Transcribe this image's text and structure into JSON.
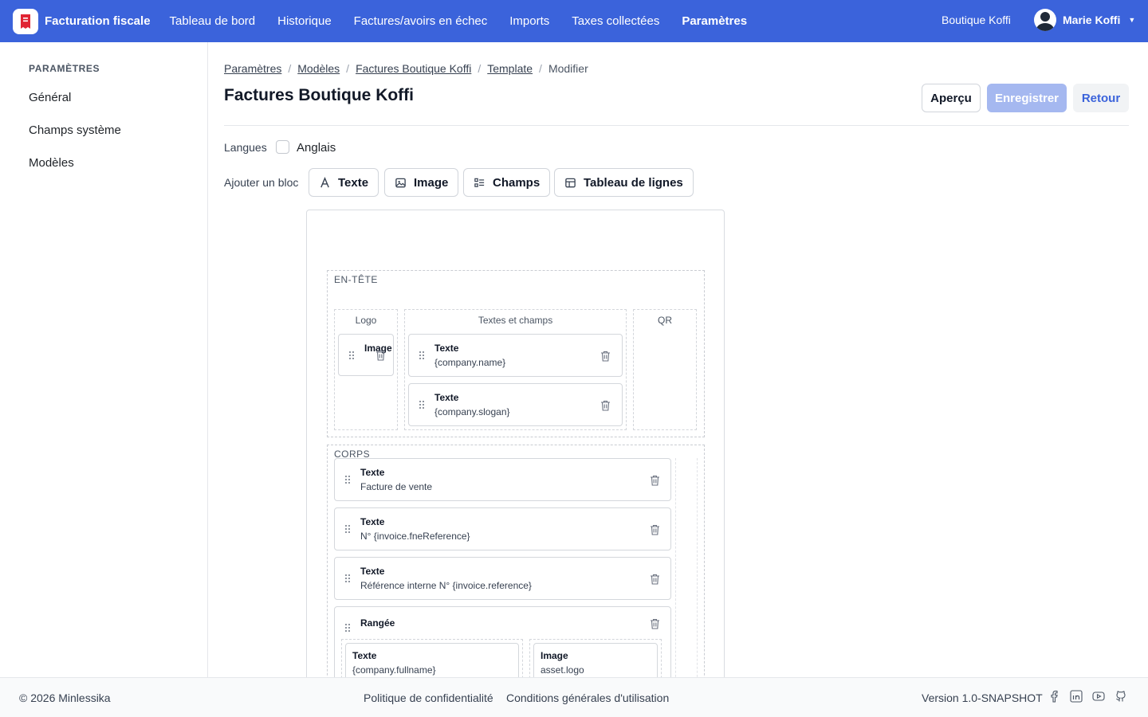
{
  "app": {
    "name": "Facturation fiscale"
  },
  "nav": {
    "items": [
      {
        "label": "Tableau de bord"
      },
      {
        "label": "Historique"
      },
      {
        "label": "Factures/avoirs en échec"
      },
      {
        "label": "Imports"
      },
      {
        "label": "Taxes collectées"
      },
      {
        "label": "Paramètres"
      }
    ],
    "active": "Paramètres"
  },
  "org": "Boutique Koffi",
  "user": {
    "name": "Marie Koffi"
  },
  "sidebar": {
    "title": "PARAMÈTRES",
    "items": [
      {
        "label": "Général"
      },
      {
        "label": "Champs système"
      },
      {
        "label": "Modèles"
      }
    ]
  },
  "breadcrumb": [
    "Paramètres",
    "Modèles",
    "Factures Boutique Koffi",
    "Template",
    "Modifier"
  ],
  "page": {
    "title": "Factures Boutique Koffi"
  },
  "actions": {
    "preview": "Aperçu",
    "save": "Enregistrer",
    "back": "Retour"
  },
  "languages": {
    "label": "Langues",
    "option": "Anglais",
    "checked": false
  },
  "add_block": {
    "label": "Ajouter un bloc",
    "buttons": [
      {
        "label": "Texte",
        "icon": "text-icon"
      },
      {
        "label": "Image",
        "icon": "image-icon"
      },
      {
        "label": "Champs",
        "icon": "fields-icon"
      },
      {
        "label": "Tableau de lignes",
        "icon": "table-icon"
      }
    ]
  },
  "template": {
    "header": {
      "label": "EN-TÊTE",
      "columns": [
        {
          "label": "Logo",
          "blocks": [
            {
              "title": "Image",
              "value": ""
            }
          ]
        },
        {
          "label": "Textes et champs",
          "blocks": [
            {
              "title": "Texte",
              "value": "{company.name}"
            },
            {
              "title": "Texte",
              "value": "{company.slogan}"
            }
          ]
        },
        {
          "label": "QR",
          "blocks": []
        }
      ]
    },
    "body": {
      "label": "CORPS",
      "blocks": [
        {
          "title": "Texte",
          "value": "Facture de vente"
        },
        {
          "title": "Texte",
          "value": "N° {invoice.fneReference}"
        },
        {
          "title": "Texte",
          "value": "Référence interne N° {invoice.reference}"
        },
        {
          "title": "Rangée",
          "children": [
            {
              "title": "Texte",
              "value": "{company.fullname}"
            },
            {
              "title": "Image",
              "value": "asset.logo"
            }
          ]
        }
      ]
    }
  },
  "footer": {
    "copyright": "© 2026 Minlessika",
    "privacy": "Politique de confidentialité",
    "terms": "Conditions générales d'utilisation",
    "version": "Version 1.0-SNAPSHOT",
    "social": [
      "facebook-icon",
      "linkedin-icon",
      "youtube-icon",
      "github-icon"
    ]
  },
  "colors": {
    "primary": "#3b63db",
    "save_disabled": "#a5b8f0"
  }
}
